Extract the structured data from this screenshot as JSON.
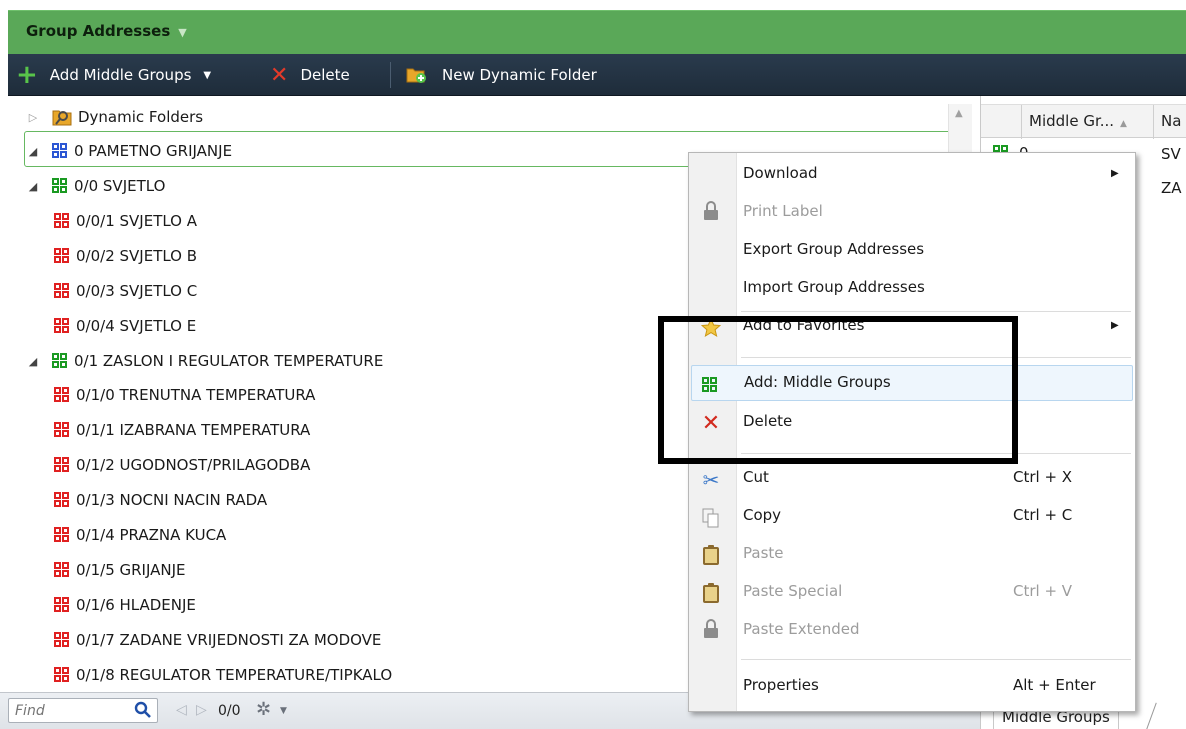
{
  "title_bar": {
    "label": "Group Addresses",
    "dropdown_icon": "triangle-down-icon"
  },
  "toolbar": {
    "add_middle_groups": "Add Middle Groups",
    "delete": "Delete",
    "new_dynamic_folder": "New Dynamic Folder"
  },
  "tree": {
    "items": [
      {
        "label": "Dynamic Folders",
        "level": 0,
        "expander": "collapsed",
        "icon": "dynamic-folder-icon"
      },
      {
        "label": "0 PAMETNO GRIJANJE",
        "level": 0,
        "expander": "expanded",
        "icon": "main-group-icon",
        "icon_color": "#2b57d4",
        "selected": true
      },
      {
        "label": "0/0 SVJETLO",
        "level": 1,
        "expander": "expanded",
        "icon": "middle-group-icon",
        "icon_color": "#1a9a22"
      },
      {
        "label": "0/0/1 SVJETLO A",
        "level": 2,
        "icon": "group-address-icon",
        "icon_color": "#e02020"
      },
      {
        "label": "0/0/2 SVJETLO B",
        "level": 2,
        "icon": "group-address-icon",
        "icon_color": "#e02020"
      },
      {
        "label": "0/0/3 SVJETLO C",
        "level": 2,
        "icon": "group-address-icon",
        "icon_color": "#e02020"
      },
      {
        "label": "0/0/4 SVJETLO E",
        "level": 2,
        "icon": "group-address-icon",
        "icon_color": "#e02020"
      },
      {
        "label": "0/1 ZASLON I REGULATOR TEMPERATURE",
        "level": 1,
        "expander": "expanded",
        "icon": "middle-group-icon",
        "icon_color": "#1a9a22"
      },
      {
        "label": "0/1/0 TRENUTNA TEMPERATURA",
        "level": 2,
        "icon": "group-address-icon",
        "icon_color": "#e02020"
      },
      {
        "label": "0/1/1 IZABRANA TEMPERATURA",
        "level": 2,
        "icon": "group-address-icon",
        "icon_color": "#e02020"
      },
      {
        "label": "0/1/2 UGODNOST/PRILAGODBA",
        "level": 2,
        "icon": "group-address-icon",
        "icon_color": "#e02020"
      },
      {
        "label": "0/1/3 NOCNI NACIN RADA",
        "level": 2,
        "icon": "group-address-icon",
        "icon_color": "#e02020"
      },
      {
        "label": "0/1/4 PRAZNA KUCA",
        "level": 2,
        "icon": "group-address-icon",
        "icon_color": "#e02020"
      },
      {
        "label": "0/1/5 GRIJANJE",
        "level": 2,
        "icon": "group-address-icon",
        "icon_color": "#e02020"
      },
      {
        "label": "0/1/6 HLADENJE",
        "level": 2,
        "icon": "group-address-icon",
        "icon_color": "#e02020"
      },
      {
        "label": "0/1/7 ZADANE VRIJEDNOSTI ZA MODOVE",
        "level": 2,
        "icon": "group-address-icon",
        "icon_color": "#e02020"
      },
      {
        "label": "0/1/8 REGULATOR TEMPERATURE/TIPKALO",
        "level": 2,
        "icon": "group-address-icon",
        "icon_color": "#e02020"
      }
    ]
  },
  "find_bar": {
    "placeholder": "Find",
    "count": "0/0"
  },
  "right_pane": {
    "columns": [
      "Middle Gr...",
      "Na"
    ],
    "rows": [
      {
        "c1": "0",
        "c2": "SV"
      },
      {
        "c1": "",
        "c2": "ZA"
      }
    ],
    "tab": "Middle Groups"
  },
  "context_menu": {
    "items": [
      {
        "label": "Download",
        "shortcut": "",
        "submenu": true,
        "disabled": false,
        "icon": ""
      },
      {
        "label": "Print Label",
        "shortcut": "",
        "submenu": false,
        "disabled": true,
        "icon": "lock-icon"
      },
      {
        "label": "Export Group Addresses",
        "shortcut": "",
        "submenu": false,
        "disabled": false,
        "icon": ""
      },
      {
        "label": "Import Group Addresses",
        "shortcut": "",
        "submenu": false,
        "disabled": false,
        "icon": ""
      },
      {
        "label": "Add to Favorites",
        "shortcut": "",
        "submenu": true,
        "disabled": false,
        "icon": "star-icon"
      },
      {
        "label": "Add: Middle Groups",
        "shortcut": "",
        "submenu": false,
        "disabled": false,
        "icon": "middle-group-icon",
        "hover": true
      },
      {
        "label": "Delete",
        "shortcut": "",
        "submenu": false,
        "disabled": false,
        "icon": "delete-x-icon"
      },
      {
        "label": "Cut",
        "shortcut": "Ctrl + X",
        "submenu": false,
        "disabled": false,
        "icon": "scissors-icon"
      },
      {
        "label": "Copy",
        "shortcut": "Ctrl + C",
        "submenu": false,
        "disabled": false,
        "icon": "copy-icon"
      },
      {
        "label": "Paste",
        "shortcut": "",
        "submenu": false,
        "disabled": true,
        "icon": "clipboard-icon"
      },
      {
        "label": "Paste Special",
        "shortcut": "Ctrl + V",
        "submenu": false,
        "disabled": true,
        "icon": "clipboard-icon"
      },
      {
        "label": "Paste Extended",
        "shortcut": "",
        "submenu": false,
        "disabled": true,
        "icon": "lock-icon"
      },
      {
        "label": "Properties",
        "shortcut": "Alt + Enter",
        "submenu": false,
        "disabled": false,
        "icon": ""
      }
    ]
  },
  "colors": {
    "title_bar_green": "#5aa858",
    "toolbar_dark": "#1e2c3a",
    "main_group_blue": "#2b57d4",
    "middle_group_green": "#1a9a22",
    "group_address_red": "#e02020",
    "selection_border": "#66b861",
    "annotation_black": "#000000"
  }
}
